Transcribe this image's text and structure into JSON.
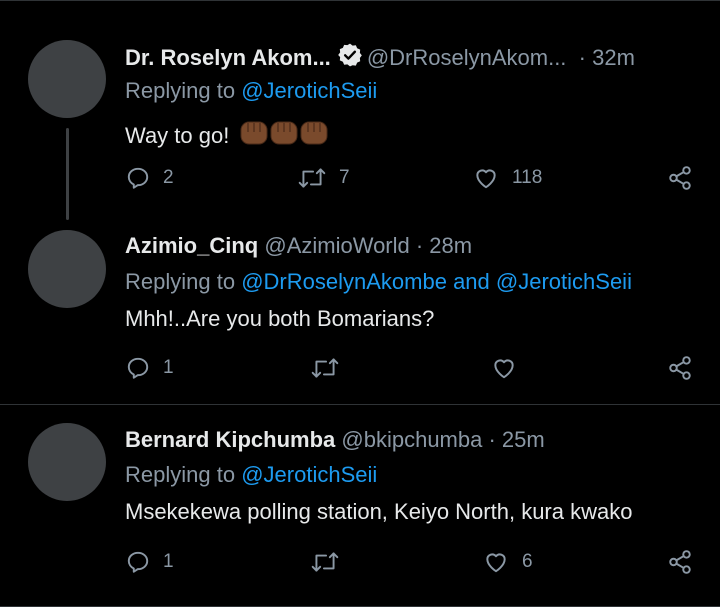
{
  "tweets": [
    {
      "name": "Dr. Roselyn Akom...",
      "handle": "@DrRoselynAkom...",
      "time": "· 32m",
      "verified": true,
      "reply_prefix": "Replying to",
      "reply_to": [
        "@JerotichSeii"
      ],
      "reply_joiner": "",
      "text": "Way to go!",
      "emoji": "raised-fist-medium-dark-skin-tone x3",
      "replies": "2",
      "retweets": "7",
      "likes": "118"
    },
    {
      "name": "Azimio_Cinq",
      "handle": "@AzimioWorld · 28m",
      "reply_prefix": "Replying to",
      "reply_to": [
        "@DrRoselynAkombe",
        "@JerotichSeii"
      ],
      "reply_joiner": "and",
      "text": "Mhh!..Are you both Bomarians?",
      "replies": "1",
      "retweets": "",
      "likes": ""
    },
    {
      "name": "Bernard Kipchumba",
      "handle": "@bkipchumba · 25m",
      "reply_prefix": "Replying to",
      "reply_to": [
        "@JerotichSeii"
      ],
      "text": "Msekekewa polling station, Keiyo North, kura kwako",
      "replies": "1",
      "retweets": "",
      "likes": "6"
    }
  ],
  "colors": {
    "background": "#000000",
    "text": "#e7e9ea",
    "muted": "#8b98a5",
    "mention": "#1d9bf0",
    "avatar": "#3e4144",
    "divider": "#2f3336"
  },
  "icons": [
    "verified-badge-icon",
    "reply-icon",
    "retweet-icon",
    "like-icon",
    "share-icon",
    "raised-fist-emoji"
  ]
}
